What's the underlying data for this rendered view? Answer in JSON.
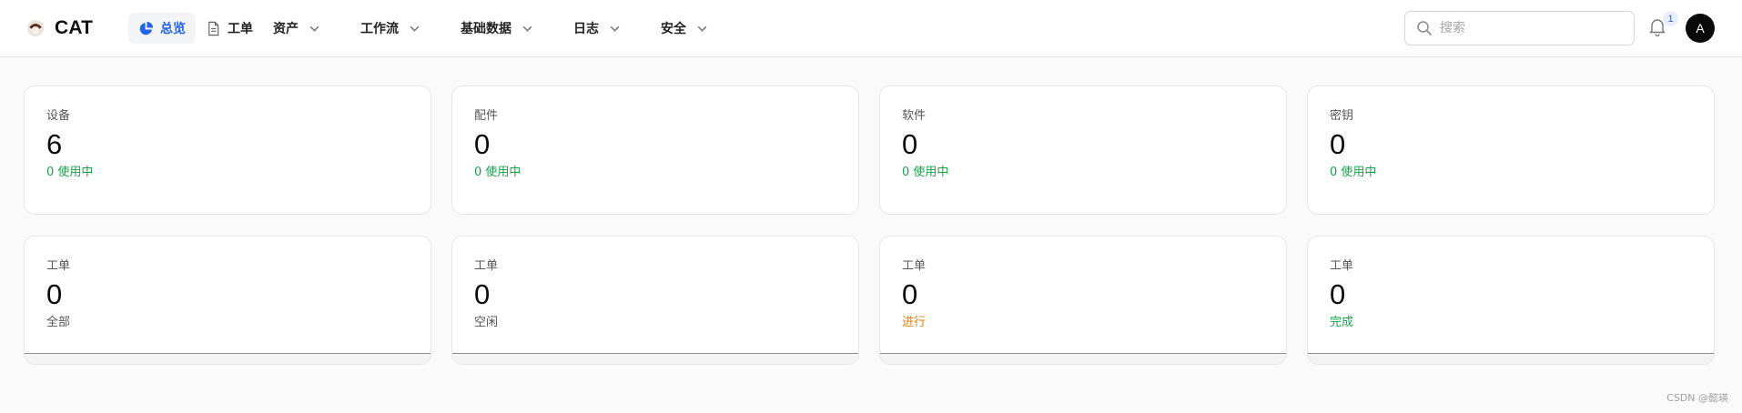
{
  "app": {
    "name": "CAT"
  },
  "nav": [
    {
      "label": "总览",
      "icon": "pie-chart-icon",
      "active": true,
      "dropdown": false
    },
    {
      "label": "工单",
      "icon": "document-icon",
      "active": false,
      "dropdown": false
    },
    {
      "label": "资产",
      "active": false,
      "dropdown": true
    },
    {
      "label": "工作流",
      "active": false,
      "dropdown": true
    },
    {
      "label": "基础数据",
      "active": false,
      "dropdown": true
    },
    {
      "label": "日志",
      "active": false,
      "dropdown": true
    },
    {
      "label": "安全",
      "active": false,
      "dropdown": true
    }
  ],
  "search": {
    "placeholder": "搜索",
    "value": ""
  },
  "notifications": {
    "count": "1"
  },
  "user": {
    "initial": "A"
  },
  "colors": {
    "accent": "#2563eb",
    "green": "#16a34a",
    "orange": "#ea7b0c",
    "muted": "#555555"
  },
  "stats": [
    {
      "label": "设备",
      "value": "6",
      "sub": "0 使用中",
      "tone": "green"
    },
    {
      "label": "配件",
      "value": "0",
      "sub": "0 使用中",
      "tone": "green"
    },
    {
      "label": "软件",
      "value": "0",
      "sub": "0 使用中",
      "tone": "green"
    },
    {
      "label": "密钥",
      "value": "0",
      "sub": "0 使用中",
      "tone": "green"
    }
  ],
  "tickets": [
    {
      "label": "工单",
      "value": "0",
      "sub": "全部",
      "tone": "muted",
      "progress": 0
    },
    {
      "label": "工单",
      "value": "0",
      "sub": "空闲",
      "tone": "muted",
      "progress": 0
    },
    {
      "label": "工单",
      "value": "0",
      "sub": "进行",
      "tone": "orange",
      "progress": 0
    },
    {
      "label": "工单",
      "value": "0",
      "sub": "完成",
      "tone": "green",
      "progress": 0
    }
  ],
  "footer": {
    "watermark": "CSDN @懿瑛"
  }
}
